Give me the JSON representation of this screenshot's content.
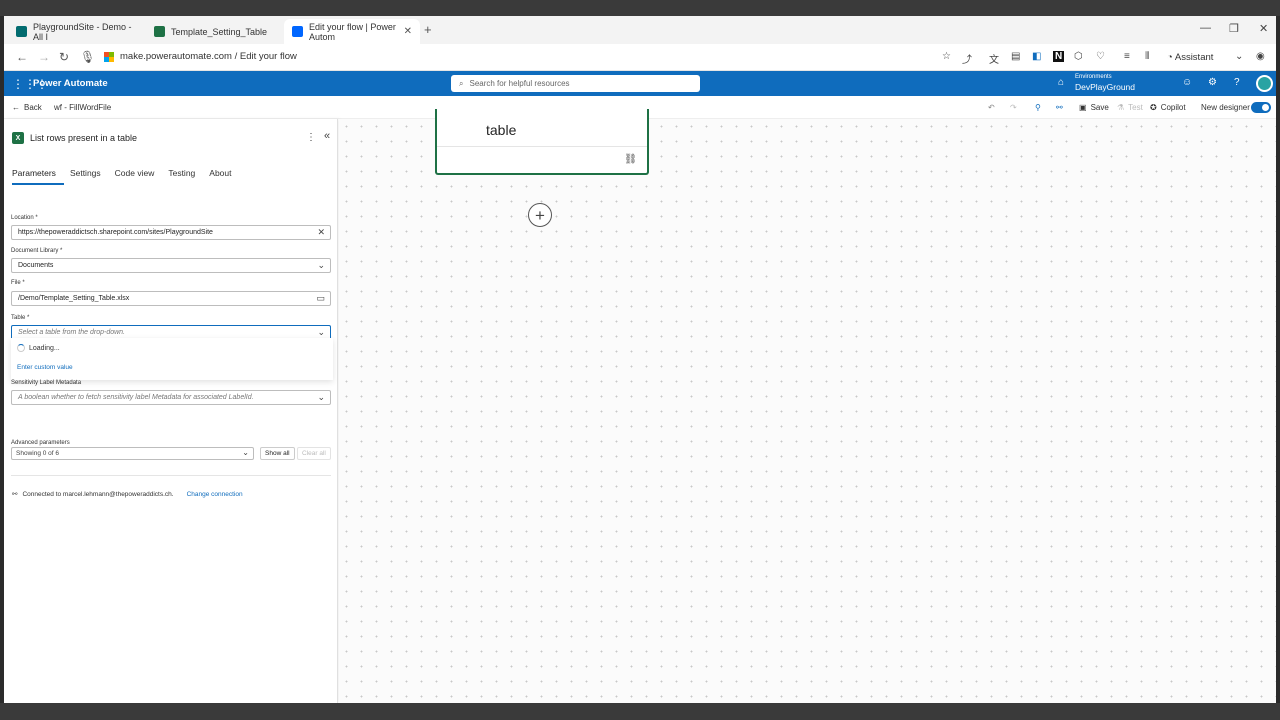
{
  "browser": {
    "tabs": [
      {
        "title": "PlaygroundSite - Demo - All I",
        "color": "#036c70"
      },
      {
        "title": "Template_Setting_Table",
        "color": "#1e7145"
      },
      {
        "title": "Edit your flow | Power Autom",
        "color": "#0066ff"
      }
    ],
    "new_tab": "+",
    "url": "make.powerautomate.com / Edit your flow",
    "assistant": "Assistant"
  },
  "header": {
    "app_title": "Power Automate",
    "search_placeholder": "Search for helpful resources",
    "env_label": "Environments",
    "env_name": "DevPlayGround"
  },
  "cmdbar": {
    "back": "Back",
    "flow_name": "wf - FillWordFile",
    "save": "Save",
    "test": "Test",
    "copilot": "Copilot",
    "new_designer": "New designer"
  },
  "panel": {
    "title": "List rows present in a table",
    "tabs": [
      "Parameters",
      "Settings",
      "Code view",
      "Testing",
      "About"
    ],
    "location_label": "Location *",
    "location_value": "https://thepoweraddictsch.sharepoint.com/sites/PlaygroundSite",
    "library_label": "Document Library *",
    "library_value": "Documents",
    "file_label": "File *",
    "file_value": "/Demo/Template_Setting_Table.xlsx",
    "table_label": "Table *",
    "table_placeholder": "Select a table from the drop-down.",
    "loading": "Loading...",
    "enter_custom": "Enter custom value",
    "sensitivity_label": "Sensitivity Label Metadata",
    "sensitivity_placeholder": "A boolean whether to fetch sensitivity label Metadata for associated LabelId.",
    "advanced_label": "Advanced parameters",
    "advanced_value": "Showing 0 of 6",
    "show_all": "Show all",
    "clear_all": "Clear all",
    "connection": "Connected to marcel.lehmann@thepoweraddicts.ch.",
    "change_connection": "Change connection"
  },
  "canvas": {
    "card_text": "table"
  }
}
